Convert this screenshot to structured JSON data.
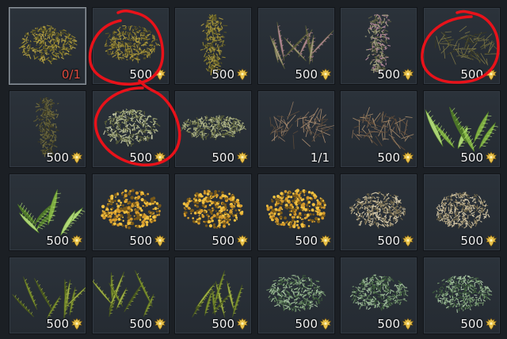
{
  "inventory": {
    "items": [
      {
        "kind": "qty",
        "label": "0/1",
        "labelColor": "#e04b3f",
        "selected": true,
        "shape": "mound",
        "colors": [
          "#5a5520",
          "#8c7f2f",
          "#b3a046"
        ],
        "plant_icon": "dried-shrub-icon"
      },
      {
        "kind": "price",
        "label": "500",
        "selected": false,
        "shape": "mound",
        "colors": [
          "#5b5424",
          "#8f7f30",
          "#a99840"
        ],
        "plant_icon": "dried-shrub-icon"
      },
      {
        "kind": "price",
        "label": "500",
        "selected": false,
        "shape": "column",
        "colors": [
          "#5a5524",
          "#8b8132",
          "#a8963f"
        ],
        "plant_icon": "tall-shrub-icon"
      },
      {
        "kind": "price",
        "label": "500",
        "selected": false,
        "shape": "fronds",
        "colors": [
          "#5c5f3a",
          "#a9a37c",
          "#b8889a"
        ],
        "plant_icon": "fern-fronds-icon"
      },
      {
        "kind": "price",
        "label": "500",
        "selected": false,
        "shape": "column",
        "colors": [
          "#5e6042",
          "#a2a07e",
          "#b2879a"
        ],
        "plant_icon": "fern-bunch-icon"
      },
      {
        "kind": "price",
        "label": "500",
        "selected": false,
        "shape": "twigs",
        "colors": [
          "#3a3a22",
          "#5b5a34",
          "#7a7446"
        ],
        "plant_icon": "dry-twigs-icon"
      },
      {
        "kind": "price",
        "label": "500",
        "selected": false,
        "shape": "column",
        "colors": [
          "#3c3b24",
          "#5b5832",
          "#6f6a3e"
        ],
        "plant_icon": "twig-bush-icon"
      },
      {
        "kind": "price",
        "label": "500",
        "selected": false,
        "shape": "mound",
        "colors": [
          "#5a5f3a",
          "#9aa272",
          "#c4c8a4"
        ],
        "plant_icon": "pale-bush-icon"
      },
      {
        "kind": "price",
        "label": "500",
        "selected": false,
        "shape": "long",
        "colors": [
          "#5a5f3a",
          "#8e9567",
          "#b3b88d"
        ],
        "plant_icon": "low-bush-icon"
      },
      {
        "kind": "qty",
        "label": "1/1",
        "labelColor": "#f2f2f2",
        "selected": false,
        "shape": "twigs",
        "colors": [
          "#5b4a3a",
          "#8d7560",
          "#a98c70"
        ],
        "plant_icon": "brown-twigs-icon"
      },
      {
        "kind": "price",
        "label": "500",
        "selected": false,
        "shape": "twigs",
        "colors": [
          "#5e4a38",
          "#8a6e55",
          "#a58a6a"
        ],
        "plant_icon": "brown-brush-icon"
      },
      {
        "kind": "price",
        "label": "500",
        "selected": false,
        "shape": "leaves",
        "colors": [
          "#4f7a27",
          "#86b844",
          "#b6e07a"
        ],
        "plant_icon": "green-leaves-icon"
      },
      {
        "kind": "price",
        "label": "500",
        "selected": false,
        "shape": "leaves",
        "colors": [
          "#4f7a27",
          "#86b844",
          "#b6e07a"
        ],
        "plant_icon": "green-leaves-icon"
      },
      {
        "kind": "price",
        "label": "500",
        "selected": false,
        "shape": "dots",
        "colors": [
          "#7a5a1a",
          "#d49a2c",
          "#f0c040"
        ],
        "plant_icon": "yellow-flowers-icon"
      },
      {
        "kind": "price",
        "label": "500",
        "selected": false,
        "shape": "dots",
        "colors": [
          "#7a5a1a",
          "#d49a2c",
          "#f0c040"
        ],
        "plant_icon": "yellow-flowers-icon"
      },
      {
        "kind": "price",
        "label": "500",
        "selected": false,
        "shape": "dots",
        "colors": [
          "#7a5a1a",
          "#d49a2c",
          "#f0c040"
        ],
        "plant_icon": "yellow-flowers-icon"
      },
      {
        "kind": "price",
        "label": "500",
        "selected": false,
        "shape": "mound",
        "colors": [
          "#6f654a",
          "#b3a582",
          "#d8ccae"
        ],
        "plant_icon": "dry-grass-icon"
      },
      {
        "kind": "price",
        "label": "500",
        "selected": false,
        "shape": "mound",
        "colors": [
          "#6f654a",
          "#b3a582",
          "#d8ccae"
        ],
        "plant_icon": "dry-grass-icon"
      },
      {
        "kind": "price",
        "label": "500",
        "selected": false,
        "shape": "fronds",
        "colors": [
          "#4a5a1e",
          "#7a8f2c",
          "#a8b84a"
        ],
        "plant_icon": "green-fronds-icon"
      },
      {
        "kind": "price",
        "label": "500",
        "selected": false,
        "shape": "fronds",
        "colors": [
          "#4a5a1e",
          "#7a8f2c",
          "#a8b84a"
        ],
        "plant_icon": "green-fronds-icon"
      },
      {
        "kind": "price",
        "label": "500",
        "selected": false,
        "shape": "fronds",
        "colors": [
          "#4a5a1e",
          "#7a8f2c",
          "#a8b84a"
        ],
        "plant_icon": "green-fronds-icon"
      },
      {
        "kind": "price",
        "label": "500",
        "selected": false,
        "shape": "mound",
        "colors": [
          "#3c5a3a",
          "#6f8f6a",
          "#a5c2a0"
        ],
        "plant_icon": "grass-clump-icon"
      },
      {
        "kind": "price",
        "label": "500",
        "selected": false,
        "shape": "mound",
        "colors": [
          "#3c5a3a",
          "#6f8f6a",
          "#a5c2a0"
        ],
        "plant_icon": "grass-clump-icon"
      },
      {
        "kind": "price",
        "label": "500",
        "selected": false,
        "shape": "mound",
        "colors": [
          "#3c5a3a",
          "#6f8f6a",
          "#a5c2a0"
        ],
        "plant_icon": "grass-clump-icon"
      }
    ]
  },
  "annotations": {
    "color": "#e8121a"
  },
  "theme": {
    "slot_bg": "#2b323a",
    "gold": "#e8c14a"
  }
}
